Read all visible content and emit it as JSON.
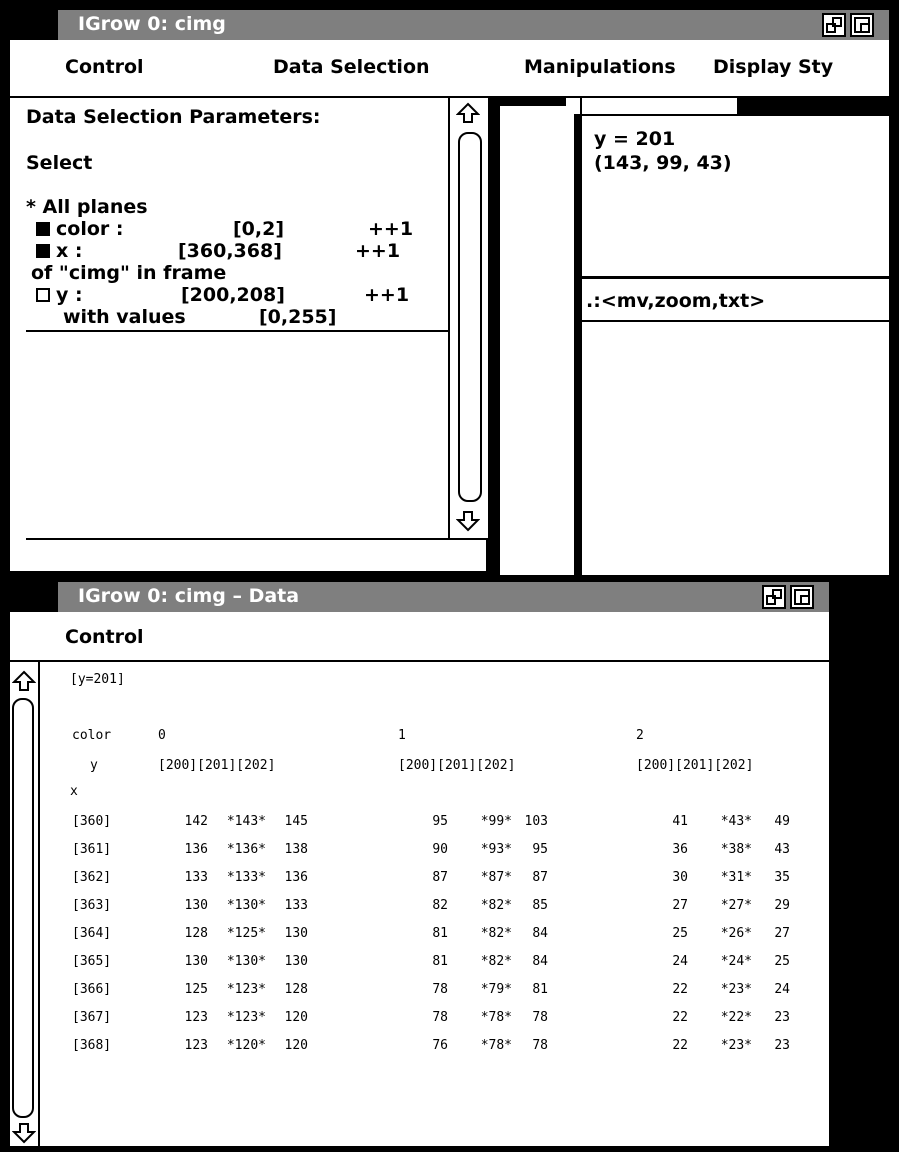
{
  "main_window": {
    "title": "IGrow 0: cimg",
    "menus": [
      "Control",
      "Data Selection",
      "Manipulations",
      "Display Sty"
    ],
    "params": {
      "heading": "Data Selection Parameters:",
      "select_label": "Select",
      "all_planes": "* All planes",
      "color_label": "color :",
      "color_range": "[0,2]",
      "color_step": "++1",
      "x_label": "x :",
      "x_range": "[360,368]",
      "x_step": "++1",
      "of_frame": "of  \"cimg\" in frame",
      "y_label": "y :",
      "y_range": "[200,208]",
      "y_step": "++1",
      "with_values": "with values",
      "values_range": "[0,255]"
    },
    "info": {
      "y_value": "y = 201",
      "rgb_value": "(143, 99, 43)",
      "command": ".:<mv,zoom,txt>"
    }
  },
  "data_window": {
    "title": "IGrow 0: cimg – Data",
    "menu": "Control",
    "header": "[y=201]",
    "color_label": "color",
    "color_groups": [
      "0",
      "1",
      "2"
    ],
    "y_label": "y",
    "y_cols": "[200][201][202]",
    "x_label": "x",
    "rows": [
      {
        "x": "[360]",
        "c0": [
          "142",
          "*143*",
          "145"
        ],
        "c1": [
          "95",
          "*99*",
          "103"
        ],
        "c2": [
          "41",
          "*43*",
          "49"
        ]
      },
      {
        "x": "[361]",
        "c0": [
          "136",
          "*136*",
          "138"
        ],
        "c1": [
          "90",
          "*93*",
          "95"
        ],
        "c2": [
          "36",
          "*38*",
          "43"
        ]
      },
      {
        "x": "[362]",
        "c0": [
          "133",
          "*133*",
          "136"
        ],
        "c1": [
          "87",
          "*87*",
          "87"
        ],
        "c2": [
          "30",
          "*31*",
          "35"
        ]
      },
      {
        "x": "[363]",
        "c0": [
          "130",
          "*130*",
          "133"
        ],
        "c1": [
          "82",
          "*82*",
          "85"
        ],
        "c2": [
          "27",
          "*27*",
          "29"
        ]
      },
      {
        "x": "[364]",
        "c0": [
          "128",
          "*125*",
          "130"
        ],
        "c1": [
          "81",
          "*82*",
          "84"
        ],
        "c2": [
          "25",
          "*26*",
          "27"
        ]
      },
      {
        "x": "[365]",
        "c0": [
          "130",
          "*130*",
          "130"
        ],
        "c1": [
          "81",
          "*82*",
          "84"
        ],
        "c2": [
          "24",
          "*24*",
          "25"
        ]
      },
      {
        "x": "[366]",
        "c0": [
          "125",
          "*123*",
          "128"
        ],
        "c1": [
          "78",
          "*79*",
          "81"
        ],
        "c2": [
          "22",
          "*23*",
          "24"
        ]
      },
      {
        "x": "[367]",
        "c0": [
          "123",
          "*123*",
          "120"
        ],
        "c1": [
          "78",
          "*78*",
          "78"
        ],
        "c2": [
          "22",
          "*22*",
          "23"
        ]
      },
      {
        "x": "[368]",
        "c0": [
          "123",
          "*120*",
          "120"
        ],
        "c1": [
          "76",
          "*78*",
          "78"
        ],
        "c2": [
          "22",
          "*23*",
          "23"
        ]
      }
    ]
  }
}
